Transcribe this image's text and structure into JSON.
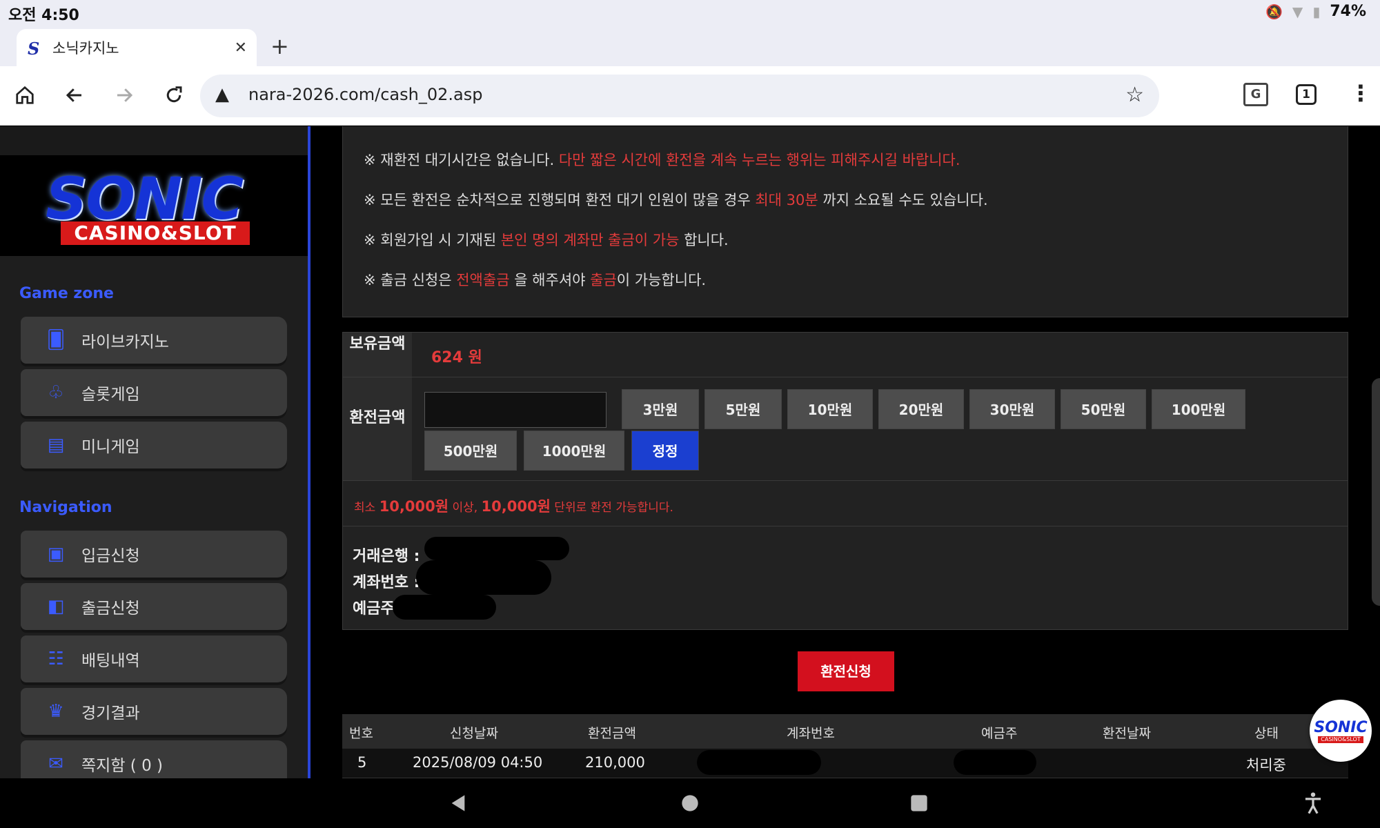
{
  "status": {
    "time": "오전 4:50",
    "battery": "74%"
  },
  "browser": {
    "tab_title": "소닉카지노",
    "tab_favicon": "S",
    "url": "nara-2026.com/cash_02.asp",
    "tab_count": "1",
    "translate_icon": "G"
  },
  "logo": {
    "word": "SONIC",
    "sub": "CASINO&SLOT"
  },
  "sidebar": {
    "game_zone_title": "Game zone",
    "game_items": [
      {
        "label": "라이브카지노",
        "icon": "live-casino-icon"
      },
      {
        "label": "슬롯게임",
        "icon": "slot-icon"
      },
      {
        "label": "미니게임",
        "icon": "mini-game-icon"
      }
    ],
    "navigation_title": "Navigation",
    "nav_items": [
      {
        "label": "입금신청",
        "icon": "deposit-icon"
      },
      {
        "label": "출금신청",
        "icon": "wallet-icon"
      },
      {
        "label": "배팅내역",
        "icon": "betting-history-icon"
      },
      {
        "label": "경기결과",
        "icon": "trophy-icon"
      },
      {
        "label": "쪽지함 ( 0 )",
        "icon": "message-icon"
      }
    ]
  },
  "notice": {
    "line1_a": "※ 재환전 대기시간은 없습니다. ",
    "line1_b": "다만 짧은 시간에 환전을 계속 누르는 행위는 피해주시길 바랍니다.",
    "line2_a": "※ 모든 환전은 순차적으로 진행되며 환전 대기 인원이 많을 경우 ",
    "line2_b": "최대 30분",
    "line2_c": " 까지 소요될 수도 있습니다.",
    "line3_a": "※ 회원가입 시 기재된 ",
    "line3_b": "본인 명의 계좌만 출금이 가능",
    "line3_c": " 합니다.",
    "line4_a": "※ 출금 신청은 ",
    "line4_b": "전액출금",
    "line4_c": " 을 해주셔야 ",
    "line4_d": "출금",
    "line4_e": "이 가능합니다."
  },
  "form": {
    "balance_label": "보유금액",
    "balance_value": "624 원",
    "amount_label": "환전금액",
    "amount_value": "",
    "amount_buttons": [
      "3만원",
      "5만원",
      "10만원",
      "20만원",
      "30만원",
      "50만원",
      "100만원",
      "500만원",
      "1000만원",
      "정정"
    ],
    "min_prefix": "최소 ",
    "min_amount": "10,000원",
    "min_mid": " 이상, ",
    "min_unit": "10,000원",
    "min_suffix": " 단위로 환전 가능합니다.",
    "bank_label": "거래은행 : ",
    "account_label": "계좌번호 : ",
    "holder_label": "예금주 : ",
    "submit_label": "환전신청"
  },
  "table": {
    "headers": [
      "번호",
      "신청날짜",
      "환전금액",
      "계좌번호",
      "예금주",
      "환전날짜",
      "상태"
    ],
    "rows": [
      {
        "no": "5",
        "date": "2025/08/09 04:50",
        "amount": "210,000",
        "account": "",
        "holder": "",
        "done_date": "",
        "status": "처리중"
      }
    ]
  },
  "colors": {
    "accent_blue": "#3b5bff",
    "alert_red": "#e43b3b",
    "submit_red": "#d3101e",
    "reset_blue": "#1b3fd0"
  }
}
